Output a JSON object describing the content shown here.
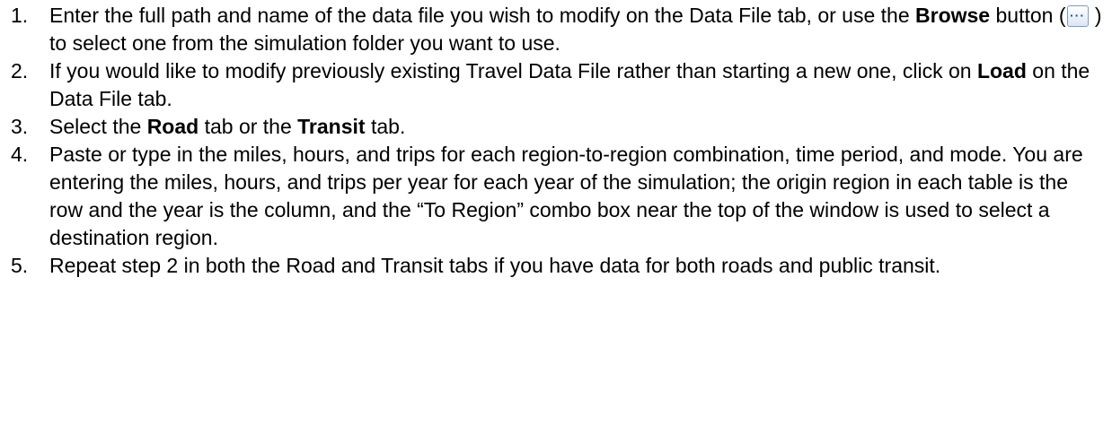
{
  "steps": [
    {
      "num": "1.",
      "parts": [
        "Enter the full path and name of the data file you wish to modify on the Data File tab, or use the ",
        "Browse",
        " button (",
        " ) to select one from the simulation folder you want to use."
      ]
    },
    {
      "num": "2.",
      "parts": [
        "If you would like to modify previously existing Travel Data File rather than starting a new one, click on ",
        "Load",
        " on the Data File tab."
      ]
    },
    {
      "num": "3.",
      "parts": [
        "Select the ",
        "Road",
        " tab or the ",
        "Transit",
        " tab."
      ]
    },
    {
      "num": "4.",
      "text": "Paste or type in the miles, hours, and trips for each region-to-region combination, time period, and mode. You are entering the miles, hours, and trips per year for each year of the simulation; the origin region in each table is the row and the year is the column, and the “To Region” combo box near the top of the window is used to select a destination region."
    },
    {
      "num": "5.",
      "text": "Repeat step 2 in both the Road and Transit tabs if you have data for both roads and public transit."
    }
  ],
  "browse_button": {
    "glyph": "···",
    "icon": "ellipsis-icon"
  }
}
